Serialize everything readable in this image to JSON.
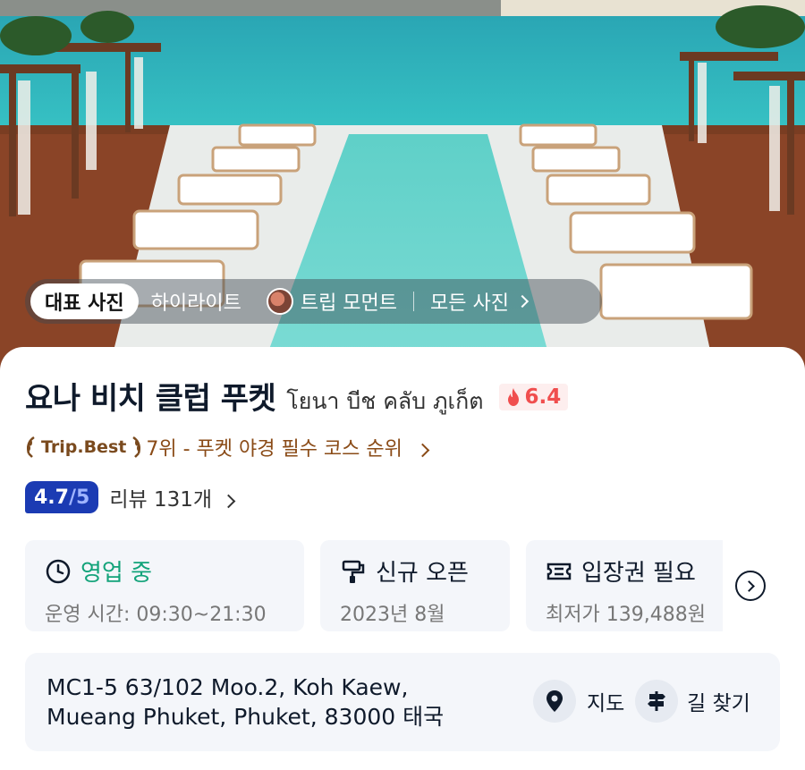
{
  "photo_tabs": {
    "main": "대표 사진",
    "highlight": "하이라이트",
    "trip_moment": "트립 모먼트",
    "all_photos": "모든 사진"
  },
  "place": {
    "name": "요나 비치 클럽 푸켓",
    "local_name": "โยนา บีช คลับ ภูเก็ต",
    "hot_score": "6.4"
  },
  "ranking": {
    "badge": "Trip.Best",
    "text": "7위 - 푸켓 야경 필수 코스 순위"
  },
  "review": {
    "score": "4.7",
    "out_of": "/5",
    "text": "리뷰 131개"
  },
  "info_cards": {
    "hours": {
      "title": "영업 중",
      "sub": "운영 시간: 09:30~21:30"
    },
    "new_open": {
      "title": "신규 오픈",
      "sub": "2023년 8월"
    },
    "ticket": {
      "title": "입장권 필요",
      "sub": "최저가 139,488원"
    }
  },
  "address": {
    "line1": "MC1-5 63/102 Moo.2, Koh Kaew,",
    "line2": "Mueang Phuket, Phuket, 83000 태국",
    "map_label": "지도",
    "route_label": "길 찾기"
  },
  "colors": {
    "accent_blue": "#1b3bb3",
    "open_green": "#13a37a",
    "hot_red": "#f04e4e",
    "tripbest_brown": "#8a4b17"
  }
}
